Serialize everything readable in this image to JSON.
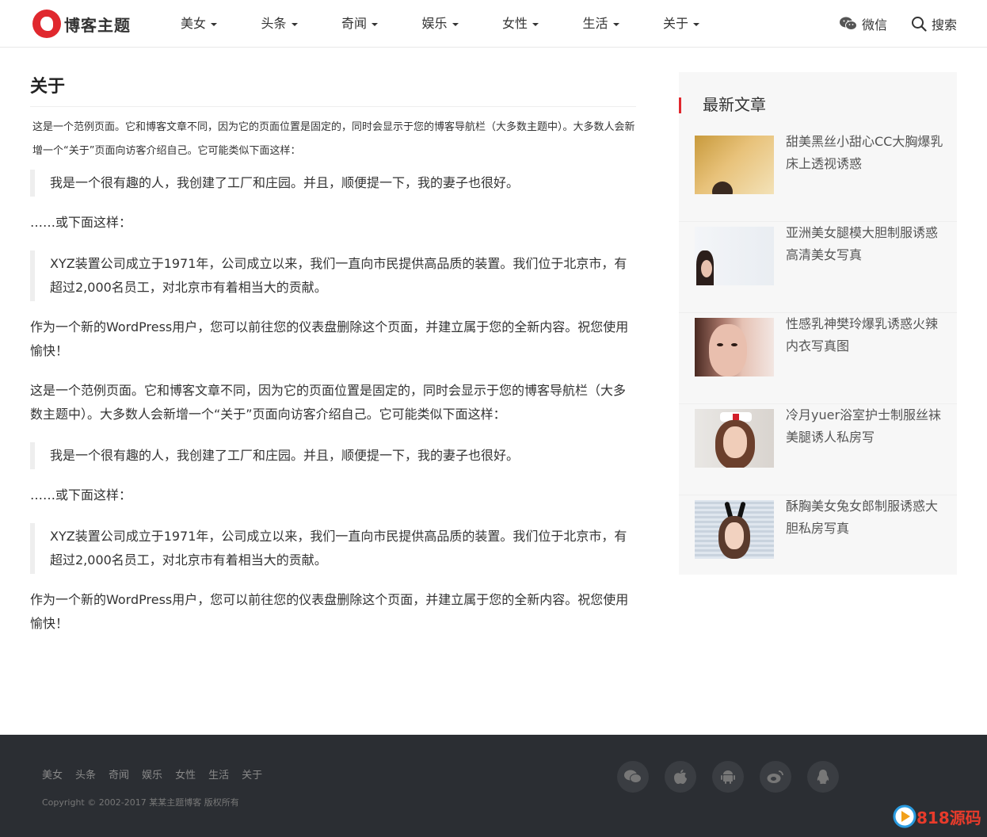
{
  "header": {
    "logo_text": "博客主题",
    "nav": [
      "美女",
      "头条",
      "奇闻",
      "娱乐",
      "女性",
      "生活",
      "关于"
    ],
    "wechat_label": "微信",
    "search_label": "搜索"
  },
  "article": {
    "title": "关于",
    "intro": "这是一个范例页面。它和博客文章不同，因为它的页面位置是固定的，同时会显示于您的博客导航栏（大多数主题中）。大多数人会新增一个“关于”页面向访客介绍自己。它可能类似下面这样：",
    "quote1": "我是一个很有趣的人，我创建了工厂和庄园。并且，顺便提一下，我的妻子也很好。",
    "or_below": "……或下面这样：",
    "quote2": "XYZ装置公司成立于1971年，公司成立以来，我们一直向市民提供高品质的装置。我们位于北京市，有超过2,000名员工，对北京市有着相当大的贡献。",
    "outro": "作为一个新的WordPress用户，您可以前往您的仪表盘删除这个页面，并建立属于您的全新内容。祝您使用愉快！",
    "intro2": "这是一个范例页面。它和博客文章不同，因为它的页面位置是固定的，同时会显示于您的博客导航栏（大多数主题中）。大多数人会新增一个“关于”页面向访客介绍自己。它可能类似下面这样：",
    "quote3": "我是一个很有趣的人，我创建了工厂和庄园。并且，顺便提一下，我的妻子也很好。",
    "or_below2": "……或下面这样：",
    "quote4": "XYZ装置公司成立于1971年，公司成立以来，我们一直向市民提供高品质的装置。我们位于北京市，有超过2,000名员工，对北京市有着相当大的贡献。",
    "outro2": "作为一个新的WordPress用户，您可以前往您的仪表盘删除这个页面，并建立属于您的全新内容。祝您使用愉快！"
  },
  "sidebar": {
    "title": "最新文章",
    "posts": [
      {
        "title": "甜美黑丝小甜心CC大胸爆乳床上透视诱惑"
      },
      {
        "title": "亚洲美女腿模大胆制服诱惑高清美女写真"
      },
      {
        "title": "性感乳神樊玲爆乳诱惑火辣内衣写真图"
      },
      {
        "title": "冷月yuer浴室护士制服丝袜美腿诱人私房写"
      },
      {
        "title": "酥胸美女兔女郎制服诱惑大胆私房写真"
      }
    ]
  },
  "footer": {
    "links": [
      "美女",
      "头条",
      "奇闻",
      "娱乐",
      "女性",
      "生活",
      "关于"
    ],
    "copyright": "Copyright © 2002-2017 某某主题博客 版权所有",
    "socials": [
      "wechat-icon",
      "apple-icon",
      "android-icon",
      "weibo-icon",
      "qq-icon"
    ],
    "brand": "818源码"
  },
  "colors": {
    "accent": "#e0282e",
    "footer_bg": "#2b2e33"
  }
}
